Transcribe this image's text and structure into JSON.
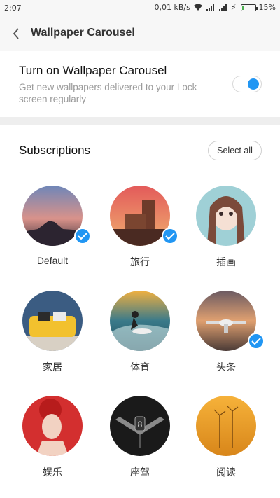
{
  "status": {
    "time": "2:07",
    "speed": "0,01 kB/s",
    "battery": "15%",
    "battery_level": 0.15
  },
  "header": {
    "title": "Wallpaper Carousel"
  },
  "carousel": {
    "title": "Turn on Wallpaper Carousel",
    "subtitle": "Get new wallpapers delivered to your Lock screen regularly",
    "enabled": true
  },
  "subscriptions": {
    "title": "Subscriptions",
    "select_all": "Select all",
    "items": [
      {
        "label": "Default",
        "selected": true
      },
      {
        "label": "旅行",
        "selected": true
      },
      {
        "label": "插画",
        "selected": false
      },
      {
        "label": "家居",
        "selected": false
      },
      {
        "label": "体育",
        "selected": false
      },
      {
        "label": "头条",
        "selected": true
      },
      {
        "label": "娱乐",
        "selected": false
      },
      {
        "label": "座驾",
        "selected": false
      },
      {
        "label": "阅读",
        "selected": false
      }
    ]
  }
}
